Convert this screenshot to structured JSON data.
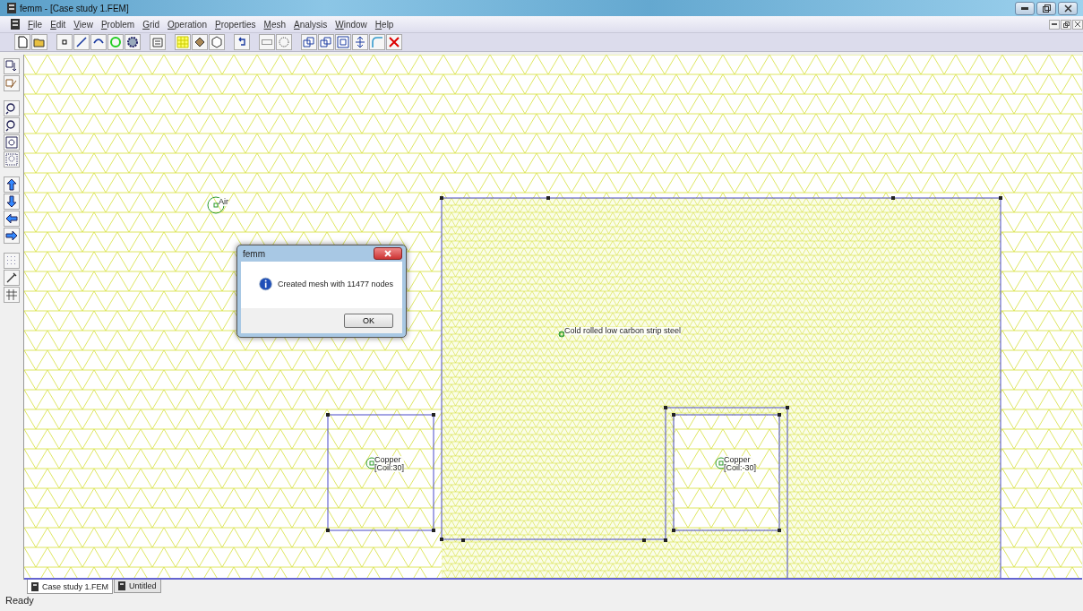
{
  "window": {
    "title": "femm - [Case study 1.FEM]"
  },
  "menu": [
    "File",
    "Edit",
    "View",
    "Problem",
    "Grid",
    "Operation",
    "Properties",
    "Mesh",
    "Analysis",
    "Window",
    "Help"
  ],
  "canvas": {
    "labels": [
      {
        "kind": "material",
        "lines": [
          "Air"
        ]
      },
      {
        "kind": "material",
        "lines": [
          "Cold rolled low carbon strip steel"
        ]
      },
      {
        "kind": "material",
        "lines": [
          "Copper",
          "[Coil:30]"
        ]
      },
      {
        "kind": "material",
        "lines": [
          "Copper",
          "[Coil:-30]"
        ]
      }
    ]
  },
  "dialog": {
    "title": "femm",
    "message": "Created mesh with 11477 nodes",
    "button": "OK"
  },
  "tabs": [
    {
      "label": "Case study 1.FEM",
      "selected": true
    },
    {
      "label": "Untitled",
      "selected": false
    }
  ],
  "status_bar": "Ready"
}
